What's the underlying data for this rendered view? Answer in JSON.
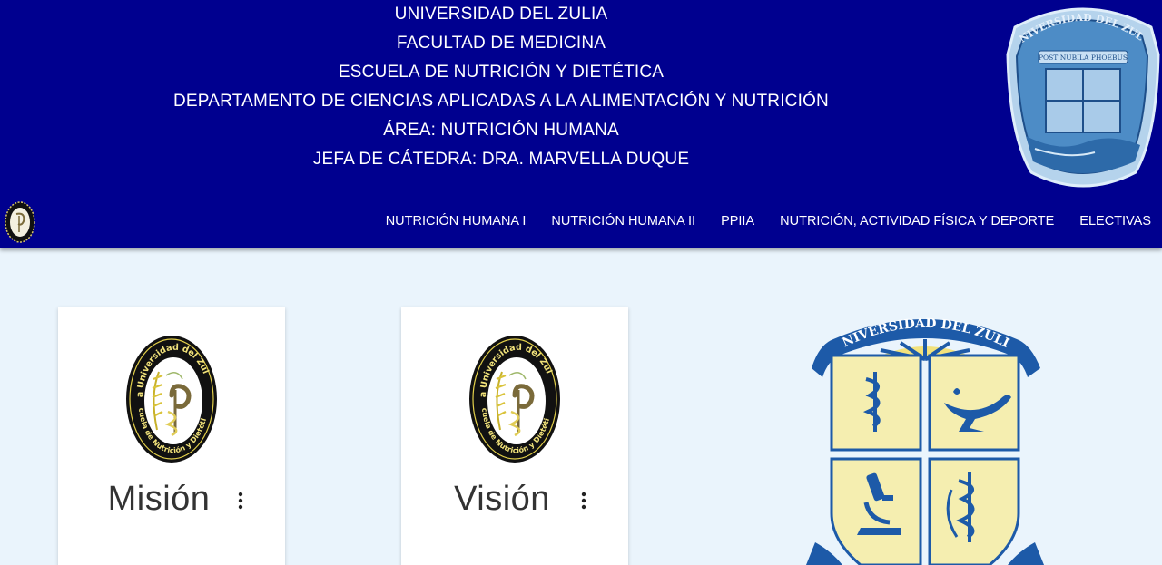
{
  "header": {
    "lines": [
      "UNIVERSIDAD DEL ZULIA",
      "FACULTAD DE MEDICINA",
      "ESCUELA DE NUTRICIÓN Y DIETÉTICA",
      "DEPARTAMENTO DE CIENCIAS APLICADAS A LA ALIMENTACIÓN Y NUTRICIÓN",
      "ÁREA: NUTRICIÓN HUMANA",
      "JEFA DE CÁTEDRA: DRA. MARVELLA DUQUE"
    ],
    "seal_text_top": "UNIVERSIDAD DEL ZULIA",
    "seal_text_ribbon": "POST NUBILA PHOEBUS"
  },
  "nav": {
    "items": [
      "NUTRICIÓN HUMANA I",
      "NUTRICIÓN HUMANA II",
      "PPIIA",
      "NUTRICIÓN, ACTIVIDAD FÍSICA Y DEPORTE",
      "ELECTIVAS"
    ]
  },
  "cards": [
    {
      "title": "Misión",
      "emblem_text_top": "La Universidad del Zulia",
      "emblem_text_bottom": "Escuela de Nutrición y Dietética"
    },
    {
      "title": "Visión",
      "emblem_text_top": "La Universidad del Zulia",
      "emblem_text_bottom": "Escuela de Nutrición y Dietética"
    }
  ],
  "crest": {
    "banner_text": "UNIVERSIDAD DEL ZULIA"
  },
  "colors": {
    "header_bg": "#00008f",
    "page_bg": "#eaf4fc",
    "crest_blue": "#1d5aa8",
    "crest_yellow": "#f5eeb0"
  },
  "icons": [
    "university-seal-icon",
    "nutrition-emblem-icon",
    "kebab-menu-icon",
    "medicine-crest-icon"
  ]
}
